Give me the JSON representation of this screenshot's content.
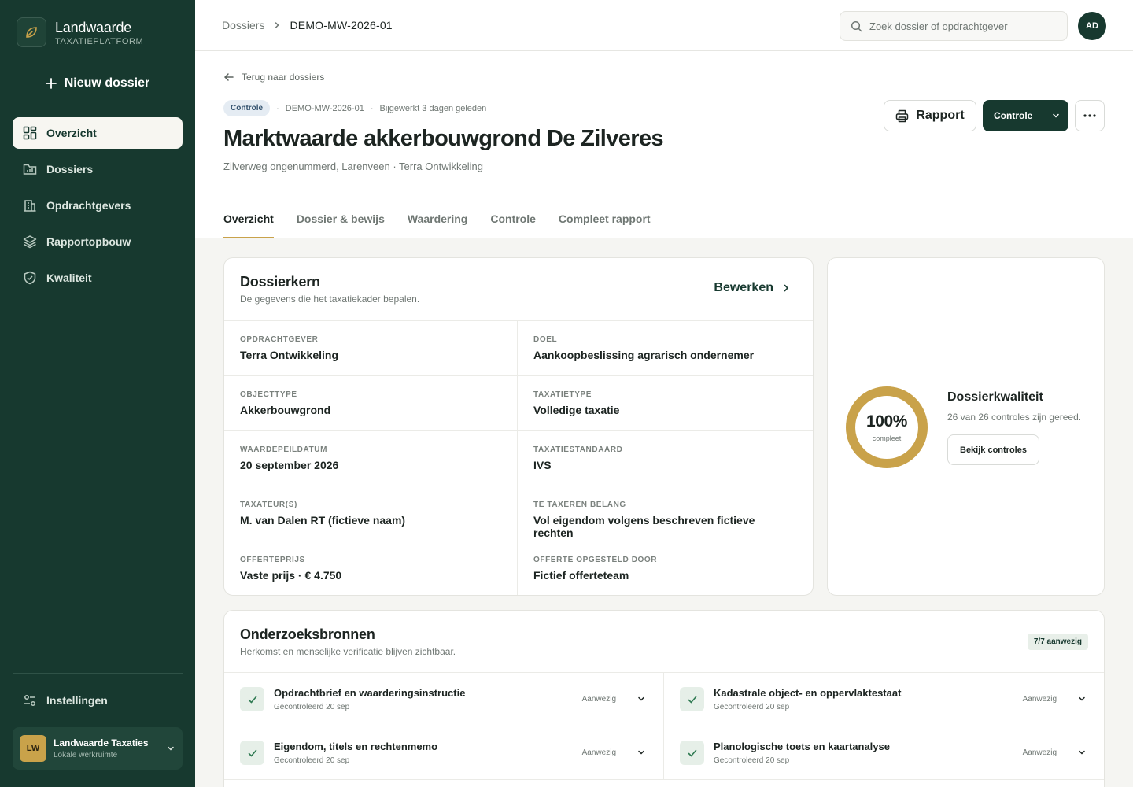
{
  "app": {
    "name": "Landwaarde",
    "subtitle": "TAXATIEPLATFORM"
  },
  "sidebar": {
    "new_label": "Nieuw dossier",
    "items": [
      {
        "label": "Overzicht"
      },
      {
        "label": "Dossiers"
      },
      {
        "label": "Opdrachtgevers"
      },
      {
        "label": "Rapportopbouw"
      },
      {
        "label": "Kwaliteit"
      }
    ],
    "settings_label": "Instellingen",
    "workspace": {
      "initials": "LW",
      "name": "Landwaarde Taxaties",
      "sub": "Lokale werkruimte"
    }
  },
  "topbar": {
    "breadcrumb": [
      "Dossiers",
      "DEMO-MW-2026-01"
    ],
    "search_placeholder": "Zoek dossier of opdrachtgever",
    "user_initials": "AD"
  },
  "header": {
    "back_label": "Terug naar dossiers",
    "status_badge": "Controle",
    "dossier_id": "DEMO-MW-2026-01",
    "updated": "Bijgewerkt 3 dagen geleden",
    "title": "Marktwaarde akkerbouwgrond De Zilveres",
    "subtitle": "Zilverweg ongenummerd, Larenveen · Terra Ontwikkeling",
    "rapport_label": "Rapport",
    "controle_label": "Controle",
    "tabs": [
      "Overzicht",
      "Dossier & bewijs",
      "Waardering",
      "Controle",
      "Compleet rapport"
    ]
  },
  "kern": {
    "title": "Dossierkern",
    "subtitle": "De gegevens die het taxatiekader bepalen.",
    "edit_label": "Bewerken",
    "fields": [
      {
        "label": "OPDRACHTGEVER",
        "value": "Terra Ontwikkeling"
      },
      {
        "label": "DOEL",
        "value": "Aankoopbeslissing agrarisch ondernemer"
      },
      {
        "label": "OBJECTTYPE",
        "value": "Akkerbouwgrond"
      },
      {
        "label": "TAXATIETYPE",
        "value": "Volledige taxatie"
      },
      {
        "label": "WAARDEPEILDATUM",
        "value": "20 september 2026"
      },
      {
        "label": "TAXATIESTANDAARD",
        "value": "IVS"
      },
      {
        "label": "TAXATEUR(S)",
        "value": "M. van Dalen RT (fictieve naam)"
      },
      {
        "label": "TE TAXEREN BELANG",
        "value": "Vol eigendom volgens beschreven fictieve rechten"
      },
      {
        "label": "OFFERTEPRIJS",
        "value": "Vaste prijs · € 4.750"
      },
      {
        "label": "OFFERTE OPGESTELD DOOR",
        "value": "Fictief offerteteam"
      }
    ]
  },
  "quality": {
    "percent_label": "100%",
    "percent_value": 100,
    "complete_label": "compleet",
    "title": "Dossierkwaliteit",
    "subtitle": "26 van 26 controles zijn gereed.",
    "button_label": "Bekijk controles",
    "ring_color": "#c9a24a"
  },
  "sources": {
    "title": "Onderzoeksbronnen",
    "subtitle": "Herkomst en menselijke verificatie blijven zichtbaar.",
    "count_label": "7/7 aanwezig",
    "items": [
      {
        "name": "Opdrachtbrief en waarderingsinstructie",
        "checked": "Gecontroleerd 20 sep",
        "status": "Aanwezig"
      },
      {
        "name": "Kadastrale object- en oppervlaktestaat",
        "checked": "Gecontroleerd 20 sep",
        "status": "Aanwezig"
      },
      {
        "name": "Eigendom, titels en rechtenmemo",
        "checked": "Gecontroleerd 20 sep",
        "status": "Aanwezig"
      },
      {
        "name": "Planologische toets en kaartanalyse",
        "checked": "Gecontroleerd 20 sep",
        "status": "Aanwezig"
      }
    ]
  },
  "colors": {
    "sidebar": "#17392f",
    "accent": "#c9a24a",
    "primary": "#17392f"
  }
}
